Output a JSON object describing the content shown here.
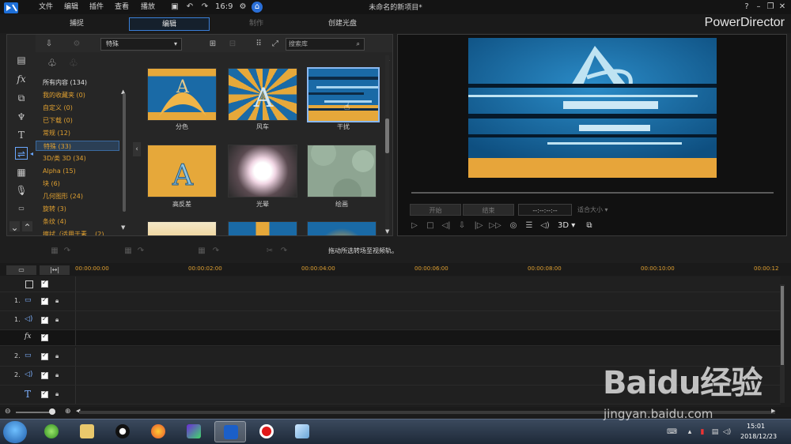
{
  "menu": {
    "items": [
      "文件",
      "编辑",
      "插件",
      "查看",
      "播放"
    ],
    "window_title": "未命名的新项目*"
  },
  "mode_tabs": [
    {
      "label": "捕捉",
      "state": "normal"
    },
    {
      "label": "编辑",
      "state": "active"
    },
    {
      "label": "制作",
      "state": "disabled"
    },
    {
      "label": "创建光盘",
      "state": "normal"
    }
  ],
  "brand": "PowerDirector",
  "library": {
    "category_select": "特殊",
    "search_placeholder": "搜索库",
    "categories": [
      {
        "label": "所有内容  (134)",
        "color": "#e0e0e0"
      },
      {
        "label": "我的收藏夹  (0)"
      },
      {
        "label": "自定义  (0)"
      },
      {
        "label": "已下载  (0)"
      },
      {
        "label": "常规  (12)"
      },
      {
        "label": "特殊  (33)",
        "selected": true
      },
      {
        "label": "3D/类 3D  (34)"
      },
      {
        "label": "Alpha  (15)"
      },
      {
        "label": "块  (6)"
      },
      {
        "label": "几何图形  (24)"
      },
      {
        "label": "旋转  (3)"
      },
      {
        "label": "条纹  (4)"
      },
      {
        "label": "擦拭（适用于素...  (2)"
      }
    ],
    "transitions": [
      {
        "label": "分色",
        "style": "split"
      },
      {
        "label": "风车",
        "style": "windmill"
      },
      {
        "label": "干扰",
        "style": "glitch",
        "selected": true
      },
      {
        "label": "高反差",
        "style": "contrast"
      },
      {
        "label": "光晕",
        "style": "glow"
      },
      {
        "label": "绘画",
        "style": "paint"
      },
      {
        "label": "",
        "style": "partial1"
      },
      {
        "label": "",
        "style": "partial2"
      },
      {
        "label": "",
        "style": "partial3"
      }
    ]
  },
  "preview": {
    "mark_in": "开始",
    "mark_out": "结束",
    "timecode": "--:--:--:--",
    "fit": "适合大小",
    "three_d": "3D"
  },
  "toolbar_hint": "拖动所选转场至视频轨。",
  "timeline": {
    "ruler": [
      "00:00:00:00",
      "00:00:02:00",
      "00:00:04:00",
      "00:00:06:00",
      "00:00:08:00",
      "00:00:10:00",
      "00:00:12"
    ],
    "tracks": [
      {
        "label": "",
        "icon": "",
        "type": "master"
      },
      {
        "label": "1.",
        "icon": "▭",
        "type": "video"
      },
      {
        "label": "1.",
        "icon": "◁)",
        "type": "audio"
      },
      {
        "label": "",
        "icon": "fx",
        "type": "fx"
      },
      {
        "label": "2.",
        "icon": "▭",
        "type": "video"
      },
      {
        "label": "2.",
        "icon": "◁)",
        "type": "audio"
      },
      {
        "label": "",
        "icon": "T",
        "type": "title"
      }
    ]
  },
  "taskbar": {
    "time": "15:01",
    "date": "2018/12/23"
  },
  "watermark": {
    "logo": "Baidu经验",
    "url": "jingyan.baidu.com"
  },
  "colors": {
    "accent": "#3a7fd8",
    "category": "#e0a030",
    "preview_blue": "#1b6fa8",
    "preview_orange": "#e7a53a"
  }
}
